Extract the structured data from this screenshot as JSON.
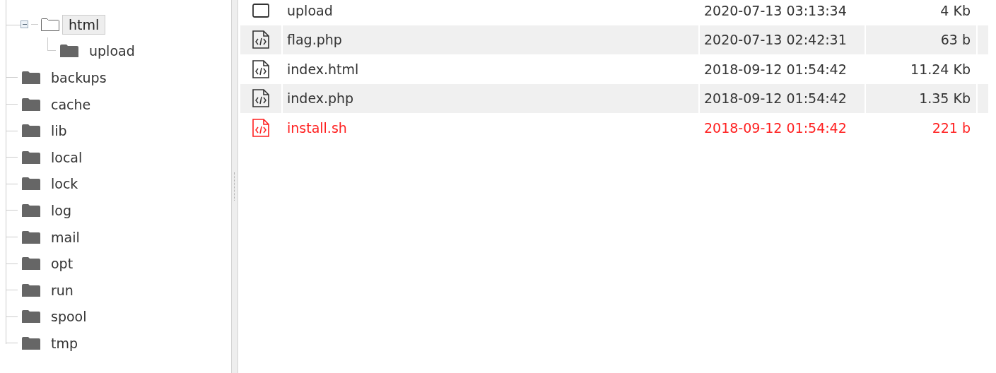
{
  "tree": [
    {
      "label": "html",
      "selected": true,
      "expanded": true,
      "children": [
        {
          "label": "upload",
          "selected": false
        }
      ]
    },
    {
      "label": "backups",
      "selected": false
    },
    {
      "label": "cache",
      "selected": false
    },
    {
      "label": "lib",
      "selected": false
    },
    {
      "label": "local",
      "selected": false
    },
    {
      "label": "lock",
      "selected": false
    },
    {
      "label": "log",
      "selected": false
    },
    {
      "label": "mail",
      "selected": false
    },
    {
      "label": "opt",
      "selected": false
    },
    {
      "label": "run",
      "selected": false
    },
    {
      "label": "spool",
      "selected": false
    },
    {
      "label": "tmp",
      "selected": false
    }
  ],
  "files": [
    {
      "kind": "folder",
      "name": "upload",
      "modified": "2020-07-13 03:13:34",
      "size": "4 Kb",
      "color": "#333333"
    },
    {
      "kind": "code",
      "name": "flag.php",
      "modified": "2020-07-13 02:42:31",
      "size": "63 b",
      "color": "#333333"
    },
    {
      "kind": "code",
      "name": "index.html",
      "modified": "2018-09-12 01:54:42",
      "size": "11.24 Kb",
      "color": "#333333"
    },
    {
      "kind": "code",
      "name": "index.php",
      "modified": "2018-09-12 01:54:42",
      "size": "1.35 Kb",
      "color": "#333333"
    },
    {
      "kind": "code",
      "name": "install.sh",
      "modified": "2018-09-12 01:54:42",
      "size": "221 b",
      "color": "#ff2020"
    }
  ]
}
